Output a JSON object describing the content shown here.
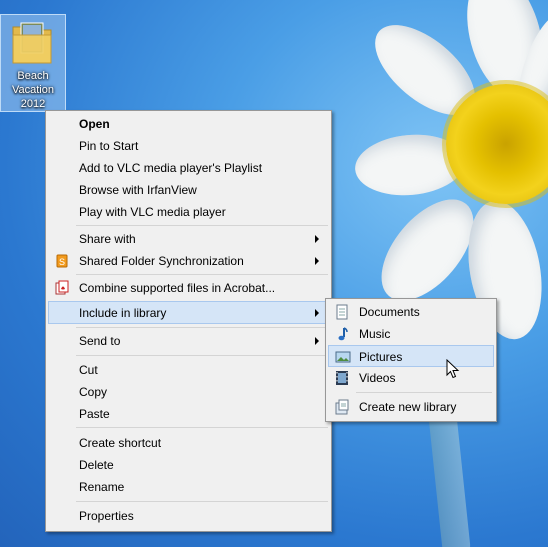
{
  "desktop": {
    "icon_label": "Beach Vacation 2012"
  },
  "context_menu": {
    "items": [
      {
        "label": "Open"
      },
      {
        "label": "Pin to Start"
      },
      {
        "label": "Add to VLC media player's Playlist"
      },
      {
        "label": "Browse with IrfanView"
      },
      {
        "label": "Play with VLC media player"
      },
      {
        "label": "Share with"
      },
      {
        "label": "Shared Folder Synchronization"
      },
      {
        "label": "Combine supported files in Acrobat..."
      },
      {
        "label": "Include in library"
      },
      {
        "label": "Send to"
      },
      {
        "label": "Cut"
      },
      {
        "label": "Copy"
      },
      {
        "label": "Paste"
      },
      {
        "label": "Create shortcut"
      },
      {
        "label": "Delete"
      },
      {
        "label": "Rename"
      },
      {
        "label": "Properties"
      }
    ]
  },
  "submenu": {
    "items": [
      {
        "label": "Documents",
        "icon": "documents-icon"
      },
      {
        "label": "Music",
        "icon": "music-icon"
      },
      {
        "label": "Pictures",
        "icon": "pictures-icon"
      },
      {
        "label": "Videos",
        "icon": "videos-icon"
      },
      {
        "label": "Create new library",
        "icon": "new-library-icon"
      }
    ]
  },
  "colors": {
    "desktop_bg": "#2f7fd6",
    "menu_bg": "#f0f0f0",
    "highlight": "#d5e5f7",
    "highlight_border": "#a9c8ee"
  }
}
